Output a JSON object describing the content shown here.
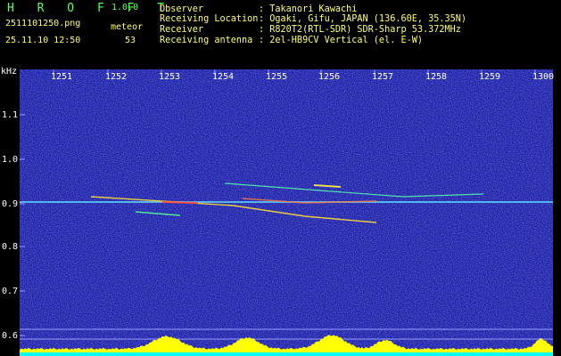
{
  "header": {
    "brand": "H R O F F T",
    "version": "1.0.0",
    "filename": "2511101250.png",
    "meteor_label": "meteor",
    "datetime": "25.11.10 12:50",
    "meteor_count": "53"
  },
  "info": [
    {
      "key": "Observer",
      "value": ": Takanori Kawachi"
    },
    {
      "key": "Receiving Location",
      "value": ": Ogaki, Gifu, JAPAN (136.60E, 35.35N)"
    },
    {
      "key": "Receiver",
      "value": ": R820T2(RTL-SDR) SDR-Sharp 53.372MHz"
    },
    {
      "key": "Receiving antenna",
      "value": ": 2el-HB9CV Vertical (el. E-W)"
    }
  ],
  "axes": {
    "y_unit": "kHz",
    "x_ticks": [
      "1251",
      "1252",
      "1253",
      "1254",
      "1255",
      "1256",
      "1257",
      "1258",
      "1259",
      "1300"
    ],
    "y_ticks": [
      "1.1",
      "1.0",
      "0.9",
      "0.8",
      "0.7",
      "0.6"
    ]
  },
  "colors": {
    "background": "#1a1aa0",
    "grid": "#9a9aff",
    "level_trace": "#ffff00",
    "baseline": "#00ffff"
  }
}
